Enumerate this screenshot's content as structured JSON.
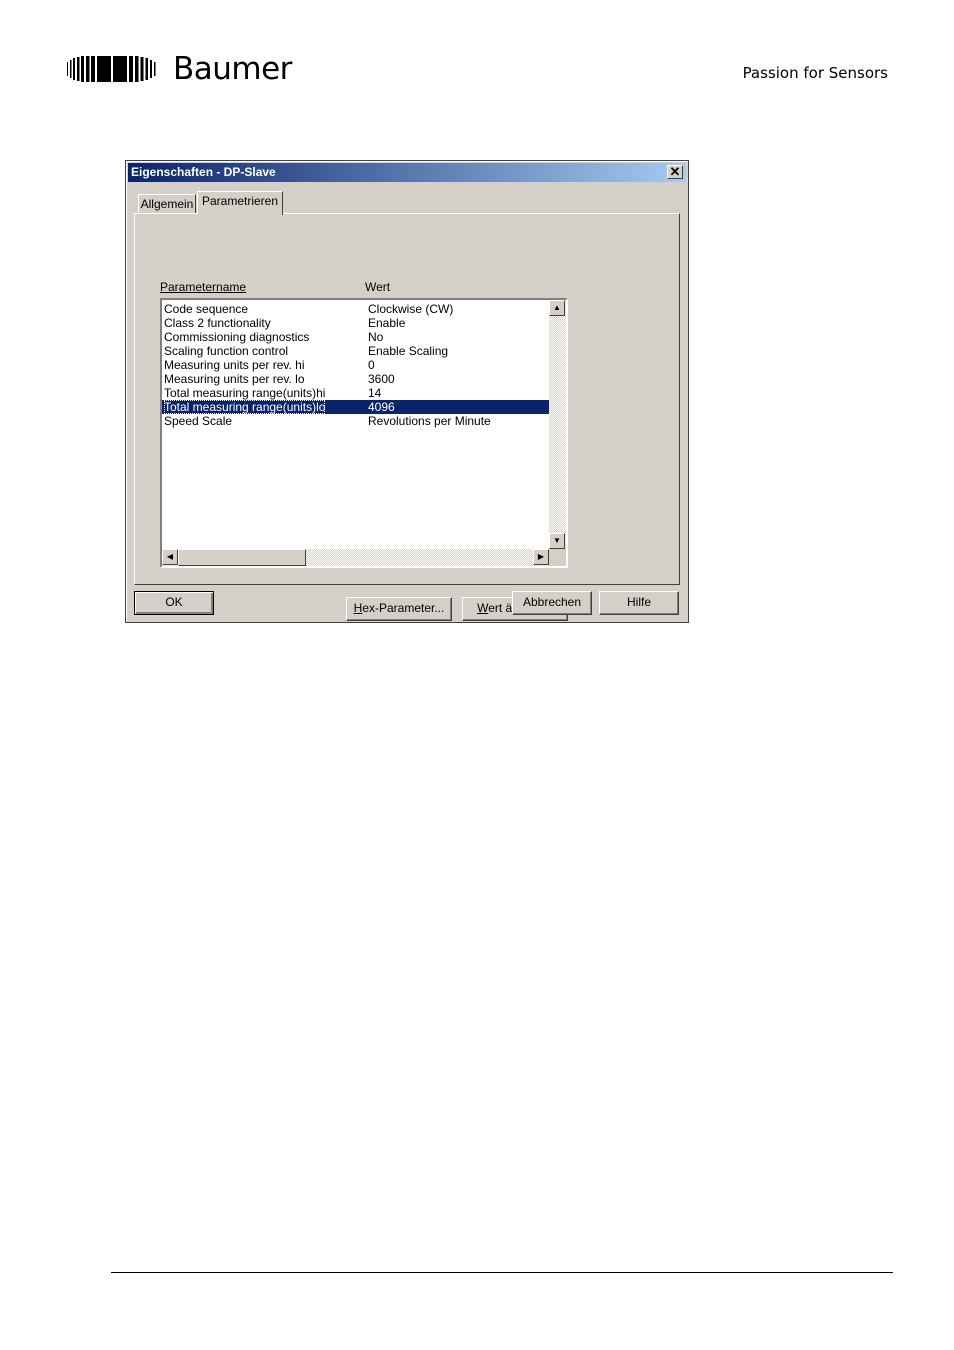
{
  "header": {
    "brand": "Baumer",
    "tagline": "Passion for Sensors"
  },
  "dialog": {
    "title": "Eigenschaften - DP-Slave",
    "close_glyph": "✕",
    "tabs": [
      {
        "label": "Allgemein",
        "active": false
      },
      {
        "label": "Parametrieren",
        "active": true
      }
    ],
    "columns": {
      "name_label": "Parametername",
      "value_label": "Wert"
    },
    "parameters": [
      {
        "name": "Code sequence",
        "value": "Clockwise (CW)"
      },
      {
        "name": "Class 2 functionality",
        "value": "Enable"
      },
      {
        "name": "Commissioning diagnostics",
        "value": "No"
      },
      {
        "name": "Scaling function control",
        "value": "Enable Scaling"
      },
      {
        "name": "Measuring units per rev. hi",
        "value": "0"
      },
      {
        "name": "Measuring units per rev. lo",
        "value": "3600"
      },
      {
        "name": "Total measuring range(units)hi",
        "value": "14"
      },
      {
        "name": "Total measuring range(units)lo",
        "value": "4096"
      },
      {
        "name": "Speed Scale",
        "value": "Revolutions per Minute"
      }
    ],
    "selected_index": 7,
    "buttons": {
      "hex_parameter": {
        "accel": "H",
        "rest": "ex-Parameter..."
      },
      "wert_aendern": {
        "accel": "W",
        "rest": "ert ändern..."
      },
      "ok": "OK",
      "abbrechen": "Abbrechen",
      "hilfe": "Hilfe"
    },
    "scroll_glyphs": {
      "up": "▲",
      "down": "▼",
      "left": "◀",
      "right": "▶"
    }
  }
}
